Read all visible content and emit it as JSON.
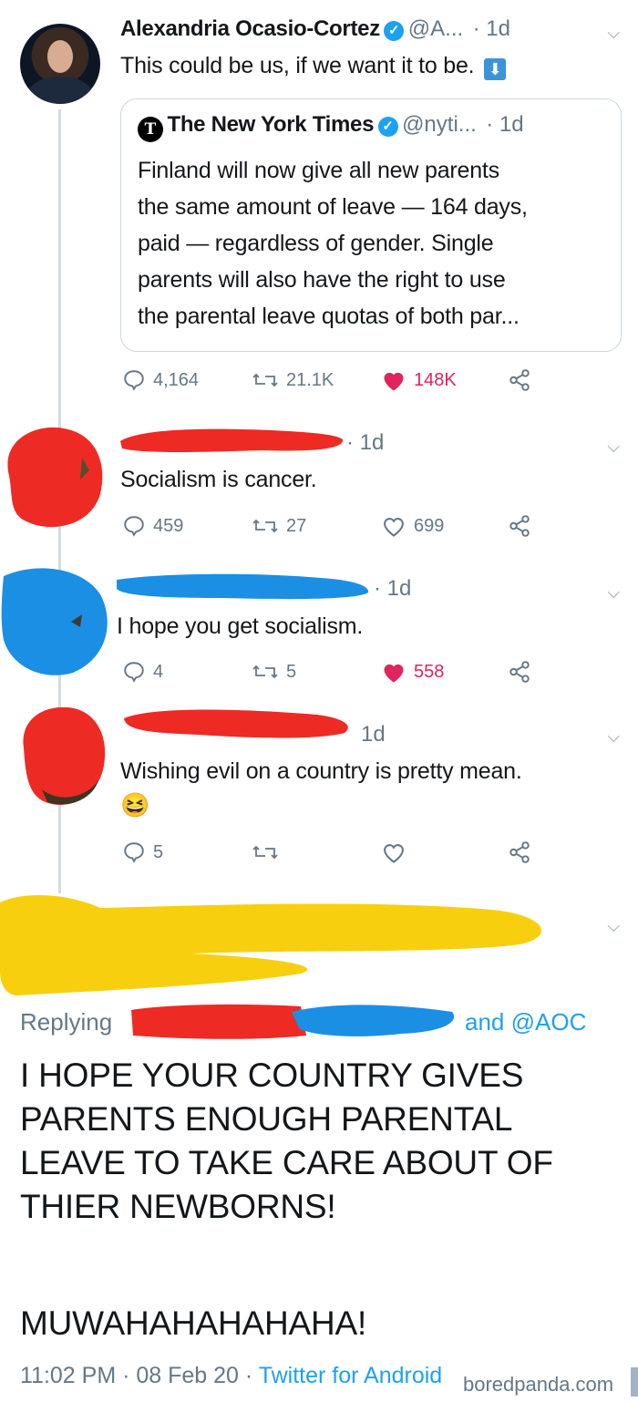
{
  "main_tweet": {
    "author": "Alexandria Ocasio-Cortez",
    "handle": "@A...",
    "time": "· 1d",
    "text": "This could be us, if we want it to be.",
    "arrow_glyph": "⬇",
    "quoted": {
      "author": "The New York Times",
      "logo_glyph": "T",
      "handle": "@nyti...",
      "time": "· 1d",
      "lines": [
        "Finland will now give all new parents",
        "the same amount of leave — 164 days,",
        "paid — regardless of gender. Single",
        "parents will also have the right to use",
        "the parental leave quotas of both par..."
      ]
    },
    "actions": {
      "replies": "4,164",
      "retweets": "21.1K",
      "likes": "148K",
      "liked": true
    }
  },
  "replies": [
    {
      "time": "· 1d",
      "text": "Socialism is cancer.",
      "emoji": "",
      "actions": {
        "replies": "459",
        "retweets": "27",
        "likes": "699",
        "liked": false
      }
    },
    {
      "time": "· 1d",
      "text": "I hope you get socialism.",
      "emoji": "",
      "actions": {
        "replies": "4",
        "retweets": "5",
        "likes": "558",
        "liked": true
      }
    },
    {
      "time": "1d",
      "text": "Wishing evil on a country is pretty mean.",
      "emoji": "😆",
      "actions": {
        "replies": "5",
        "retweets": "",
        "likes": "",
        "liked": false
      }
    }
  ],
  "final_reply": {
    "replying_prefix": "Replying",
    "replying_suffix": "and @AOC",
    "lines": [
      "I HOPE YOUR COUNTRY GIVES",
      "PARENTS ENOUGH PARENTAL",
      "LEAVE TO TAKE CARE ABOUT OF",
      "THIER NEWBORNS!"
    ],
    "exclamation": "MUWAHAHAHAHAHA!",
    "timestamp": "11:02 PM · 08 Feb 20 · ",
    "client": "Twitter for Android"
  },
  "watermark": "boredpanda.com",
  "colors": {
    "like_red": "#e0245e",
    "link_blue": "#1da1f2",
    "redact_red": "#ee2a24",
    "redact_blue": "#1b8fe4",
    "redact_yellow": "#f7cf0e"
  }
}
